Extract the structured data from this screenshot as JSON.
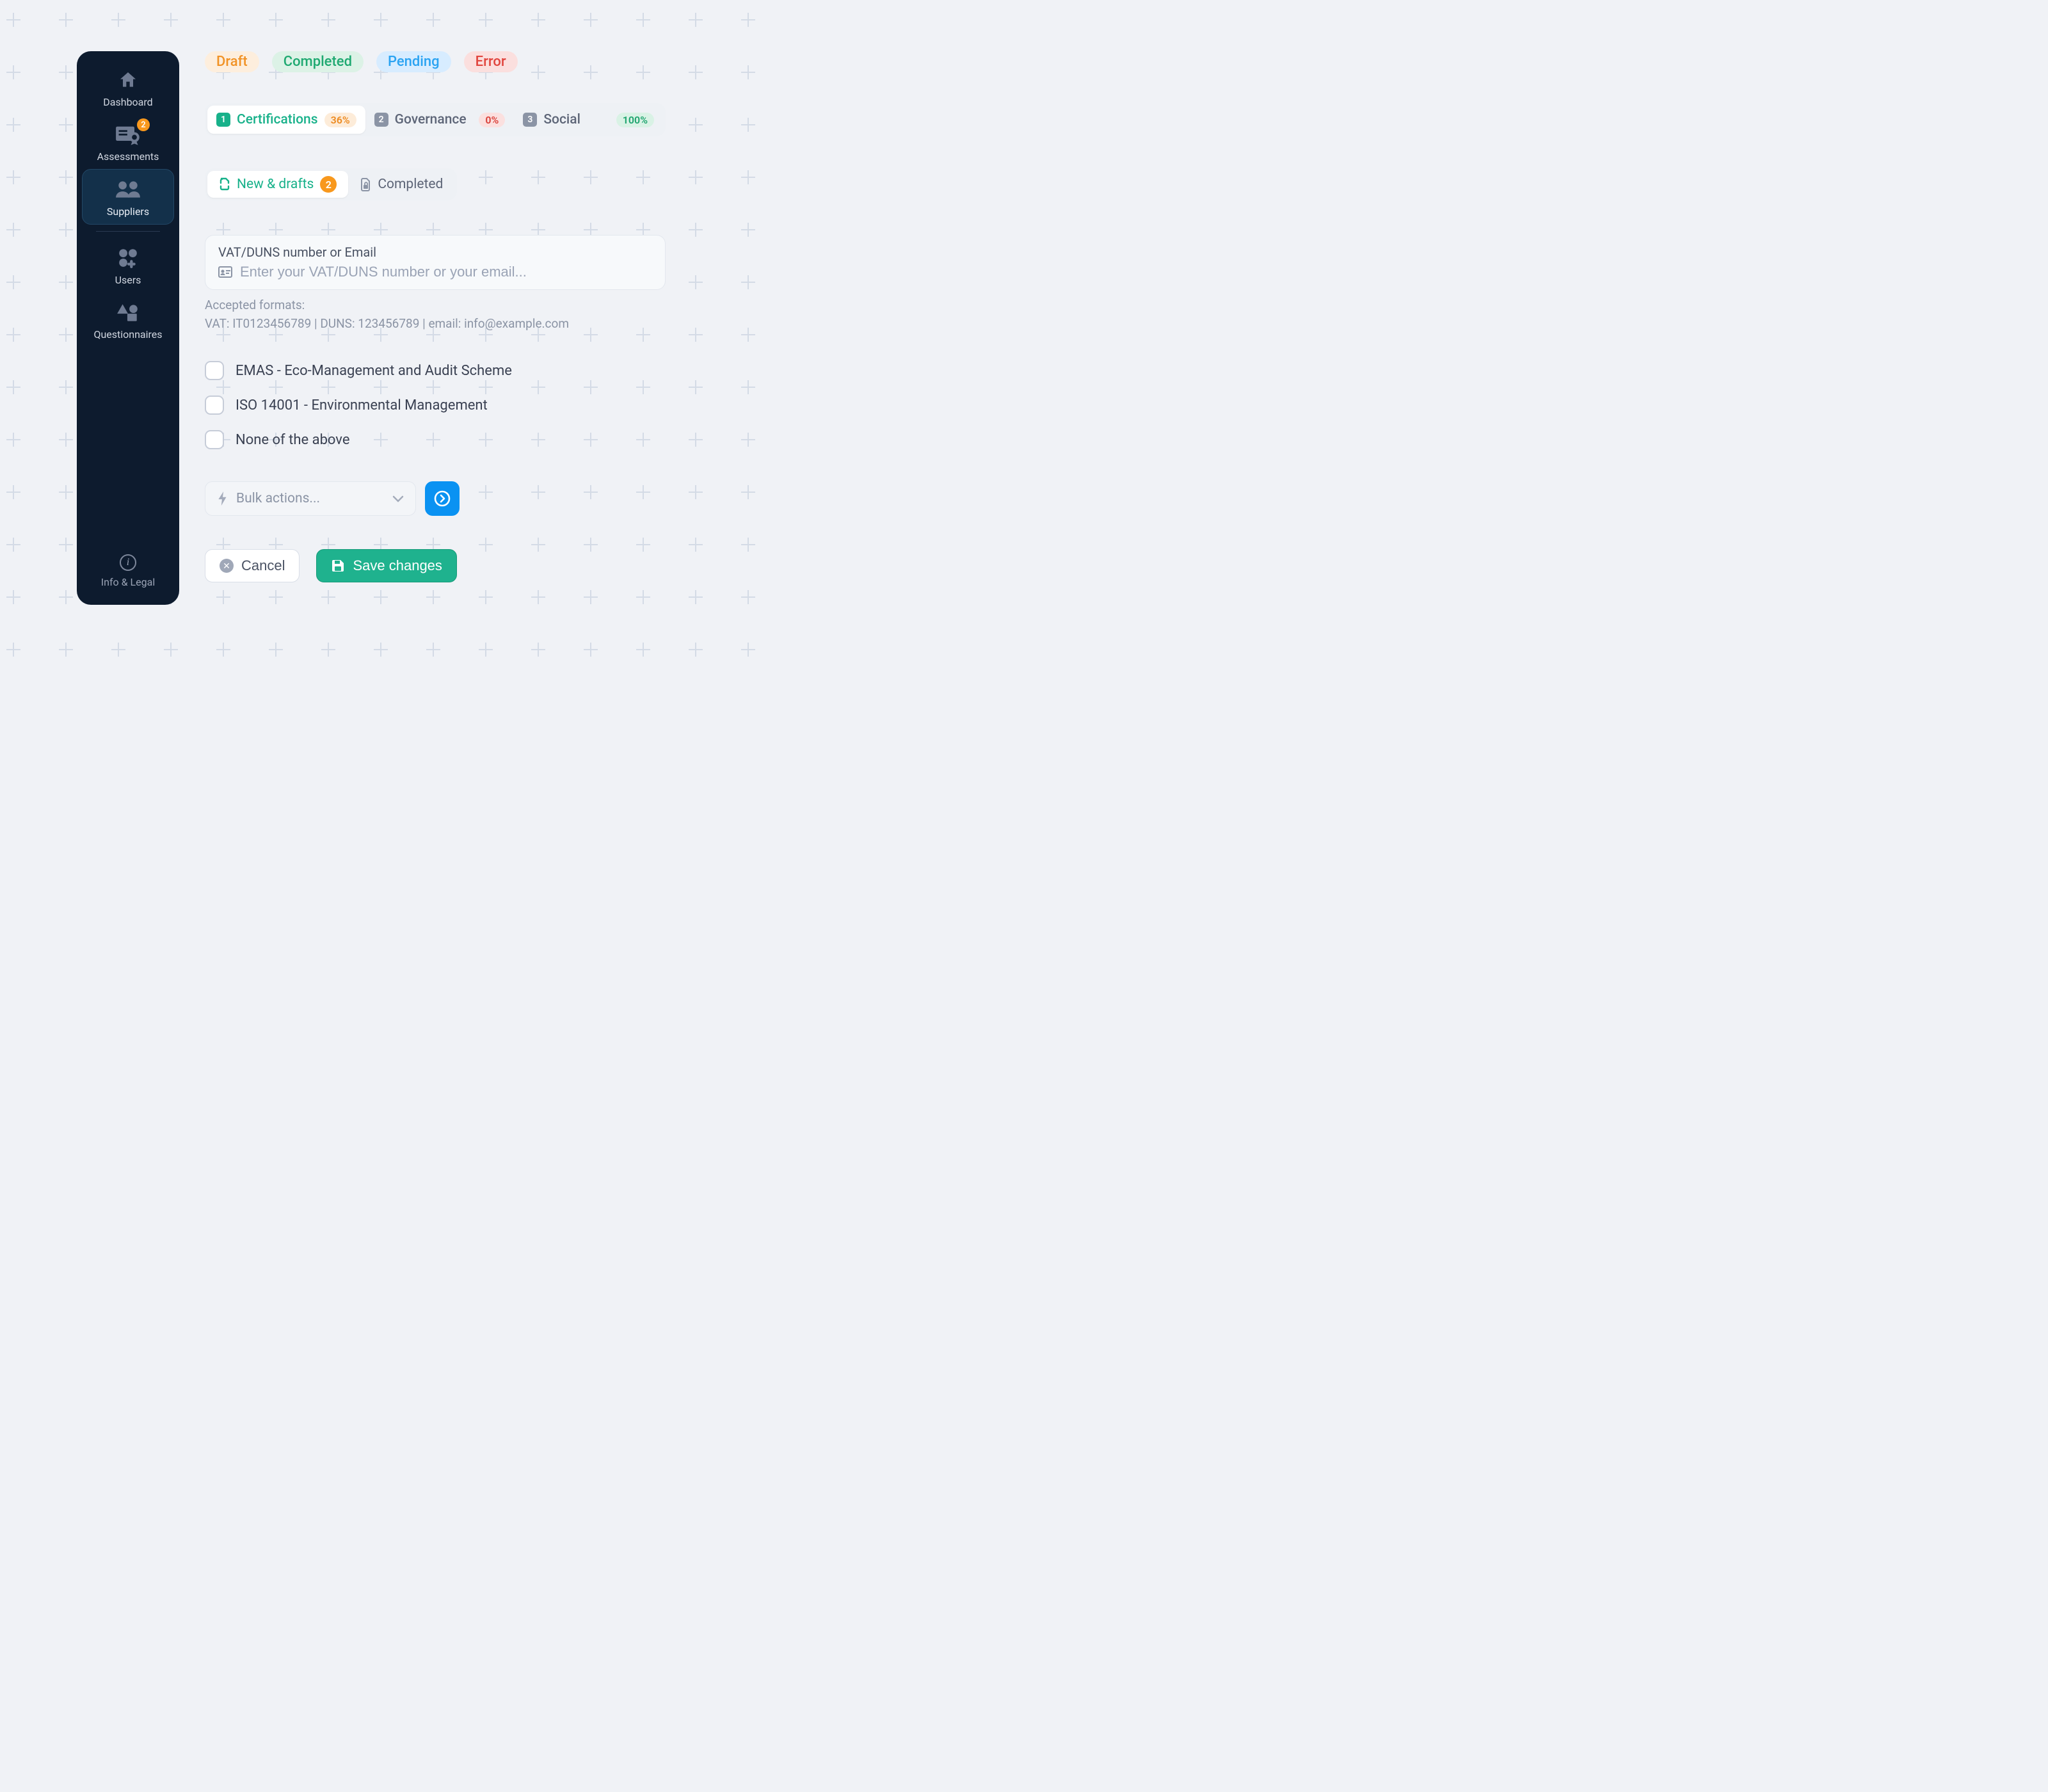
{
  "sidebar": {
    "items": [
      {
        "label": "Dashboard",
        "badge": null
      },
      {
        "label": "Assessments",
        "badge": "2"
      },
      {
        "label": "Suppliers",
        "badge": null
      },
      {
        "label": "Users",
        "badge": null
      },
      {
        "label": "Questionnaires",
        "badge": null
      }
    ],
    "footer_label": "Info & Legal"
  },
  "status": {
    "draft": "Draft",
    "completed": "Completed",
    "pending": "Pending",
    "error": "Error"
  },
  "steps": [
    {
      "num": "1",
      "label": "Certifications",
      "pct": "36%"
    },
    {
      "num": "2",
      "label": "Governance",
      "pct": "0%"
    },
    {
      "num": "3",
      "label": "Social",
      "pct": "100%"
    }
  ],
  "subtabs": {
    "new": "New & drafts",
    "new_badge": "2",
    "completed": "Completed"
  },
  "input": {
    "label": "VAT/DUNS number or Email",
    "placeholder": "Enter your VAT/DUNS number or your email..."
  },
  "hint": {
    "line1": "Accepted formats:",
    "line2": "VAT: IT0123456789 | DUNS: 123456789 | email: info@example.com"
  },
  "checks": [
    "EMAS - Eco-Management and Audit Scheme",
    "ISO 14001 - Environmental Management",
    "None of the above"
  ],
  "bulk": {
    "placeholder": "Bulk actions..."
  },
  "buttons": {
    "cancel": "Cancel",
    "save": "Save changes"
  }
}
